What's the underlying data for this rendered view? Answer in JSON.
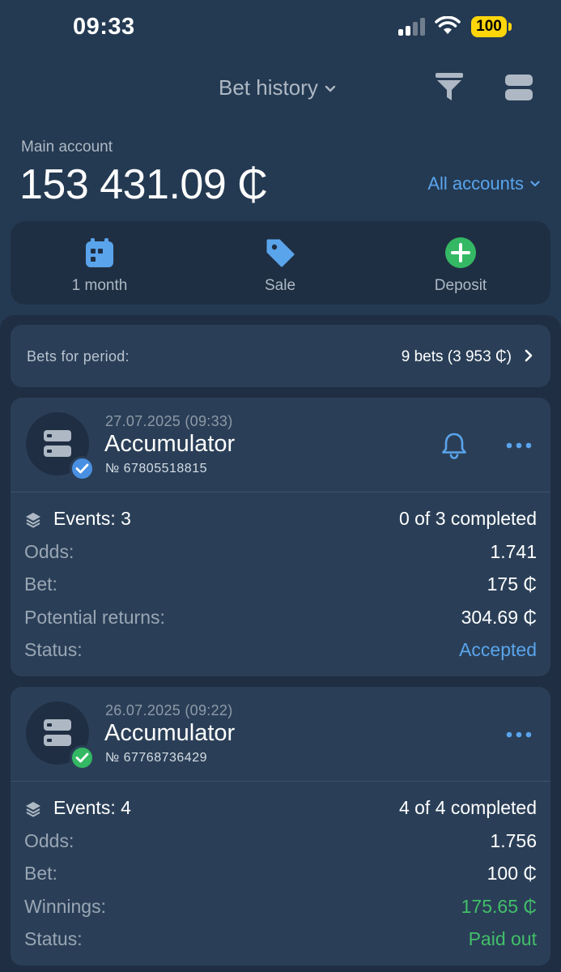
{
  "status_bar": {
    "time": "09:33",
    "battery": "100"
  },
  "header": {
    "title": "Bet history"
  },
  "account": {
    "label": "Main account",
    "balance": "153 431.09 ₵",
    "switcher": "All accounts"
  },
  "actions": [
    {
      "label": "1 month",
      "icon": "calendar-icon"
    },
    {
      "label": "Sale",
      "icon": "tag-icon"
    },
    {
      "label": "Deposit",
      "icon": "plus-circle-icon"
    }
  ],
  "period": {
    "label": "Bets for period:",
    "value": "9 bets (3 953 ₵)"
  },
  "bets": [
    {
      "date": "27.07.2025 (09:33)",
      "type": "Accumulator",
      "number": "№ 67805518815",
      "events_label": "Events: 3",
      "events_progress": "0 of 3 completed",
      "odds_label": "Odds:",
      "odds": "1.741",
      "bet_label": "Bet:",
      "bet": "175 ₵",
      "returns_label": "Potential returns:",
      "returns": "304.69 ₵",
      "status_label": "Status:",
      "status": "Accepted",
      "badge_color": "#4a90e2"
    },
    {
      "date": "26.07.2025 (09:22)",
      "type": "Accumulator",
      "number": "№ 67768736429",
      "events_label": "Events: 4",
      "events_progress": "4 of 4 completed",
      "odds_label": "Odds:",
      "odds": "1.756",
      "bet_label": "Bet:",
      "bet": "100 ₵",
      "returns_label": "Winnings:",
      "returns": "175.65 ₵",
      "status_label": "Status:",
      "status": "Paid out",
      "badge_color": "#34b864"
    }
  ],
  "colors": {
    "background": "#243a52",
    "card": "#2a3f57",
    "accent_blue": "#5aa4ec",
    "success_green": "#42bf6a",
    "battery_yellow": "#ffd60a"
  }
}
